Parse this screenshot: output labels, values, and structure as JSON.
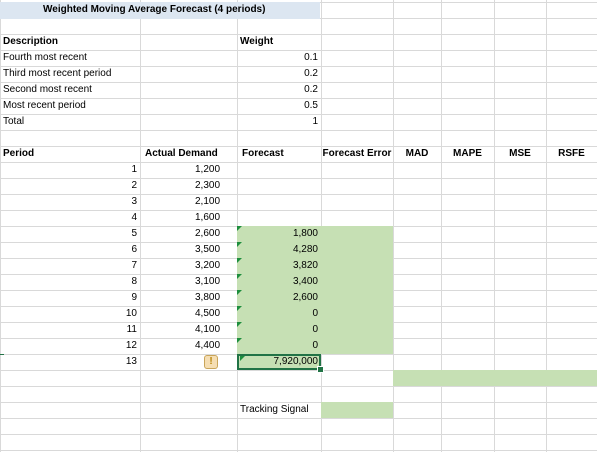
{
  "title": "Weighted Moving Average Forecast (4 periods)",
  "weights": {
    "header_description": "Description",
    "header_weight": "Weight",
    "rows": [
      {
        "label": "Fourth most recent",
        "value": "0.1"
      },
      {
        "label": "Third most recent period",
        "value": "0.2"
      },
      {
        "label": "Second most recent",
        "value": "0.2"
      },
      {
        "label": "Most recent period",
        "value": "0.5"
      },
      {
        "label": "Total",
        "value": "1"
      }
    ]
  },
  "table": {
    "headers": {
      "period": "Period",
      "actual": "Actual Demand",
      "forecast": "Forecast",
      "error": "Forecast Error",
      "mad": "MAD",
      "mape": "MAPE",
      "mse": "MSE",
      "rsfe": "RSFE"
    },
    "rows": [
      {
        "period": "1",
        "actual": "1,200",
        "forecast": ""
      },
      {
        "period": "2",
        "actual": "2,300",
        "forecast": ""
      },
      {
        "period": "3",
        "actual": "2,100",
        "forecast": ""
      },
      {
        "period": "4",
        "actual": "1,600",
        "forecast": ""
      },
      {
        "period": "5",
        "actual": "2,600",
        "forecast": "1,800"
      },
      {
        "period": "6",
        "actual": "3,500",
        "forecast": "4,280"
      },
      {
        "period": "7",
        "actual": "3,200",
        "forecast": "3,820"
      },
      {
        "period": "8",
        "actual": "3,100",
        "forecast": "3,400"
      },
      {
        "period": "9",
        "actual": "3,800",
        "forecast": "2,600"
      },
      {
        "period": "10",
        "actual": "4,500",
        "forecast": "0"
      },
      {
        "period": "11",
        "actual": "4,100",
        "forecast": "0"
      },
      {
        "period": "12",
        "actual": "4,400",
        "forecast": "0"
      },
      {
        "period": "13",
        "actual": "",
        "forecast": "7,920,000"
      }
    ]
  },
  "tracking_signal_label": "Tracking Signal",
  "warning_icon": "!",
  "colors": {
    "title_fill": "#dce6f1",
    "highlight_green": "#c6e0b4",
    "selection_border": "#217346"
  }
}
